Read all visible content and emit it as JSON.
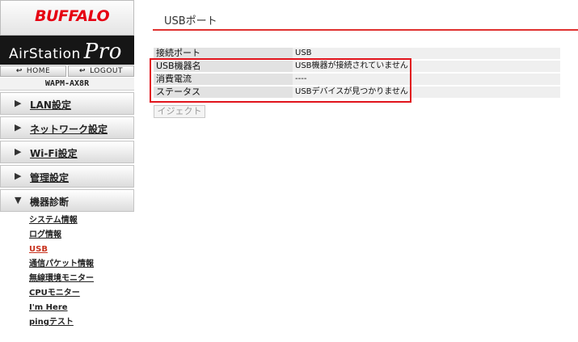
{
  "sidebar": {
    "logo": "BUFFALO",
    "brand": {
      "name": "AirStation",
      "tier": "Pro"
    },
    "home_label": "HOME",
    "logout_label": "LOGOUT",
    "model": "WAPM-AX8R",
    "menu": [
      {
        "label": "LAN設定",
        "expanded": false
      },
      {
        "label": "ネットワーク設定",
        "expanded": false
      },
      {
        "label": "Wi-Fi設定",
        "expanded": false
      },
      {
        "label": "管理設定",
        "expanded": false
      },
      {
        "label": "機器診断",
        "expanded": true
      }
    ],
    "submenu": [
      {
        "label": "システム情報"
      },
      {
        "label": "ログ情報"
      },
      {
        "label": "USB",
        "active": true
      },
      {
        "label": "通信パケット情報"
      },
      {
        "label": "無線環境モニター"
      },
      {
        "label": "CPUモニター"
      },
      {
        "label": "I'm Here"
      },
      {
        "label": "pingテスト"
      }
    ]
  },
  "main": {
    "title": "USBポート",
    "rows": [
      {
        "key": "接続ポート",
        "value": "USB"
      },
      {
        "key": "USB機器名",
        "value": "USB機器が接続されていません"
      },
      {
        "key": "消費電流",
        "value": "----"
      },
      {
        "key": "ステータス",
        "value": "USBデバイスが見つかりません"
      }
    ],
    "eject_label": "イジェクト"
  },
  "colors": {
    "accent_red": "#e60012",
    "highlight_border": "#e1141c",
    "active_link": "#c8321e"
  }
}
